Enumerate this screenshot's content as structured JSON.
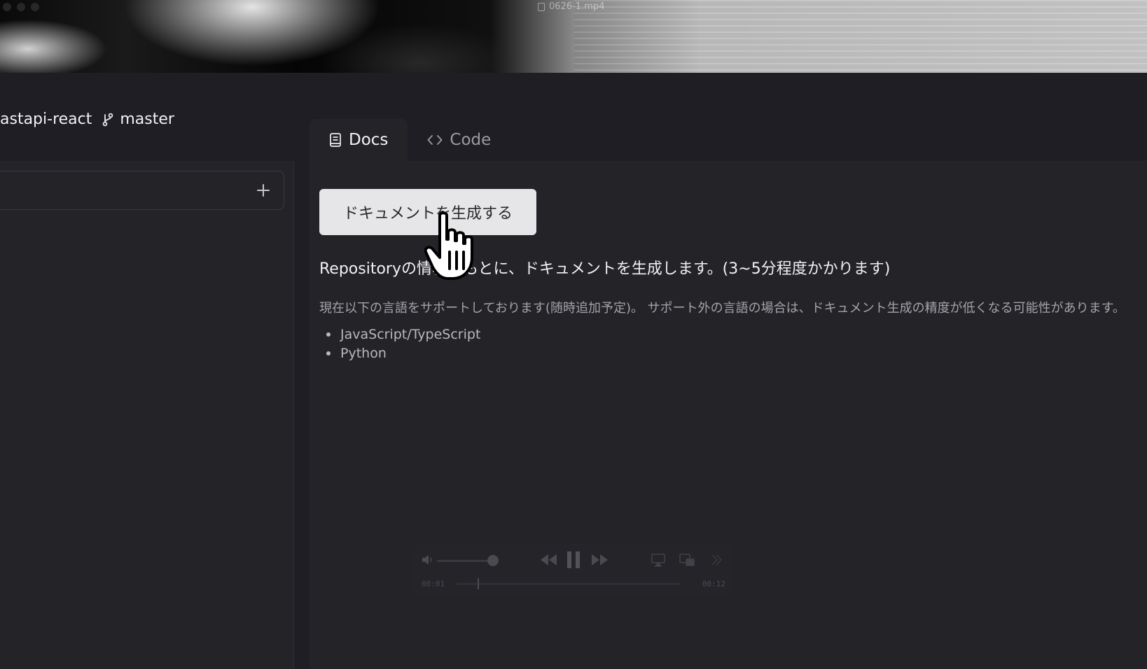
{
  "window": {
    "title": "0626-1.mp4"
  },
  "repo": {
    "name": "astapi-react",
    "branch": "master"
  },
  "sidebar": {
    "add_icon": "plus-icon"
  },
  "tabs": [
    {
      "label": "Docs",
      "icon": "book-icon",
      "active": true
    },
    {
      "label": "Code",
      "icon": "code-icon",
      "active": false
    }
  ],
  "main": {
    "generate_button_label": "ドキュメントを生成する",
    "headline": "Repositoryの情報をもとに、ドキュメントを生成します。(3~5分程度かかります)",
    "support_text": "現在以下の言語をサポートしております(随時追加予定)。 サポート外の言語の場合は、ドキュメント生成の精度が低くなる可能性があります。",
    "languages": [
      "JavaScript/TypeScript",
      "Python"
    ]
  },
  "player": {
    "time_elapsed": "00:01",
    "time_total": "00:12"
  },
  "colors": {
    "background": "#1e1e24",
    "panel": "#232328",
    "button": "#e6e6e8",
    "text_primary": "#f2f2f4",
    "text_muted": "#a3a3a9"
  }
}
